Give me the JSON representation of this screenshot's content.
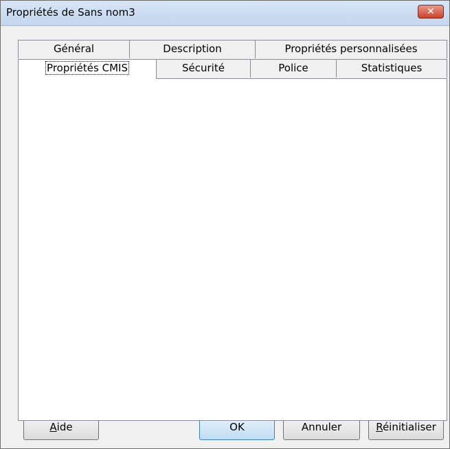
{
  "window": {
    "title": "Propriétés de Sans nom3",
    "close_label": "✕"
  },
  "tabs_row1": [
    {
      "label": "Général"
    },
    {
      "label": "Description"
    },
    {
      "label": "Propriétés personnalisées"
    }
  ],
  "tabs_row2": [
    {
      "label": "Propriétés CMIS",
      "active": true
    },
    {
      "label": "Sécurité"
    },
    {
      "label": "Police"
    },
    {
      "label": "Statistiques"
    }
  ],
  "buttons": {
    "help": {
      "label_mnemonic": "A",
      "label_rest": "ide"
    },
    "ok": {
      "label": "OK"
    },
    "cancel": {
      "label": "Annuler"
    },
    "reset": {
      "label_mnemonic": "R",
      "label_rest": "éinitialiser"
    }
  }
}
